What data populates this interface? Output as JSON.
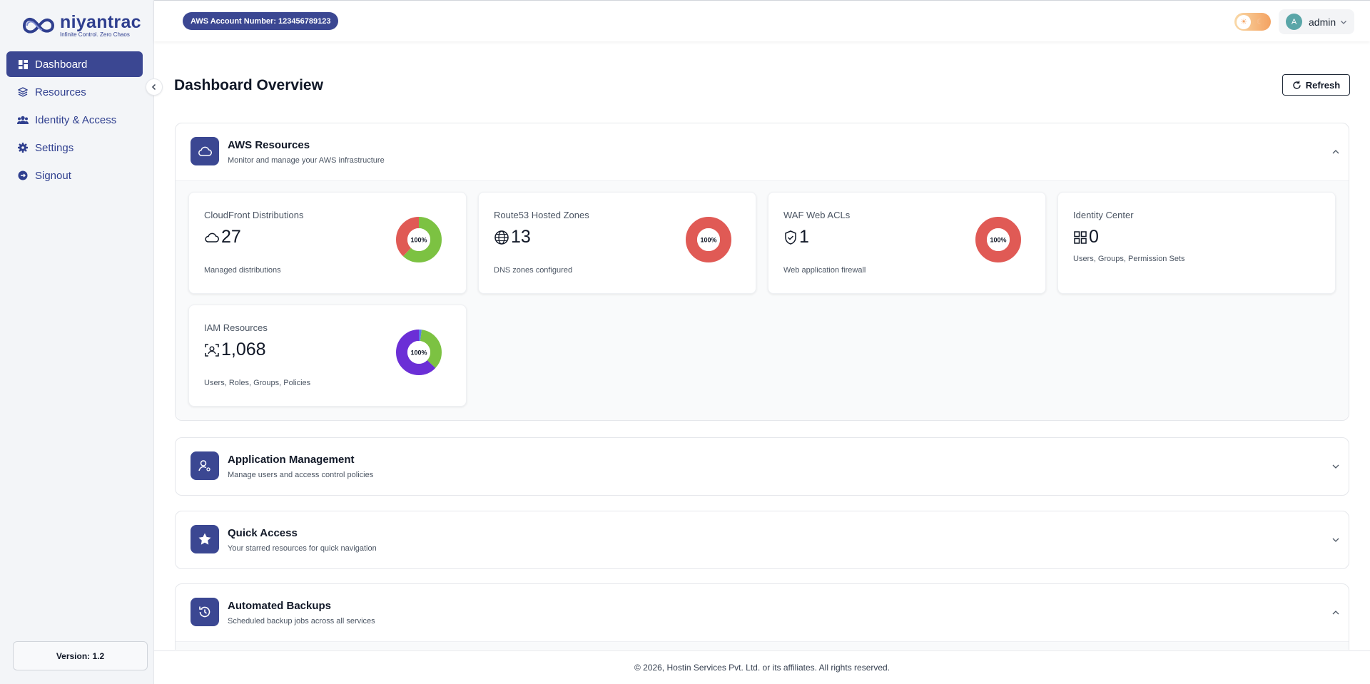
{
  "brand": {
    "name": "niyantrac",
    "tagline": "Infinite Control. Zero Chaos"
  },
  "sidebar": {
    "items": [
      {
        "label": "Dashboard",
        "icon": "grid-icon",
        "active": true
      },
      {
        "label": "Resources",
        "icon": "layers-icon",
        "active": false
      },
      {
        "label": "Identity & Access",
        "icon": "users-icon",
        "active": false
      },
      {
        "label": "Settings",
        "icon": "gear-icon",
        "active": false
      },
      {
        "label": "Signout",
        "icon": "signout-icon",
        "active": false
      }
    ],
    "version": "Version: 1.2"
  },
  "topbar": {
    "account": "AWS Account Number: 123456789123",
    "user": {
      "initial": "A",
      "name": "admin"
    }
  },
  "page": {
    "title": "Dashboard Overview",
    "refresh_label": "Refresh"
  },
  "sections": {
    "aws": {
      "title": "AWS Resources",
      "subtitle": "Monitor and manage your AWS infrastructure",
      "expanded": true
    },
    "app": {
      "title": "Application Management",
      "subtitle": "Manage users and access control policies",
      "expanded": false
    },
    "quick": {
      "title": "Quick Access",
      "subtitle": "Your starred resources for quick navigation",
      "expanded": false
    },
    "backups": {
      "title": "Automated Backups",
      "subtitle": "Scheduled backup jobs across all services",
      "expanded": true
    }
  },
  "cards": [
    {
      "title": "CloudFront Distributions",
      "value": "27",
      "desc": "Managed distributions",
      "icon": "cloud-icon",
      "donut_label": "100%"
    },
    {
      "title": "Route53 Hosted Zones",
      "value": "13",
      "desc": "DNS zones configured",
      "icon": "globe-icon",
      "donut_label": "100%"
    },
    {
      "title": "WAF Web ACLs",
      "value": "1",
      "desc": "Web application firewall",
      "icon": "shield-icon",
      "donut_label": "100%"
    },
    {
      "title": "Identity Center",
      "value": "0",
      "desc": "Users, Groups, Permission Sets",
      "icon": "apps-icon"
    },
    {
      "title": "IAM Resources",
      "value": "1,068",
      "desc": "Users, Roles, Groups, Policies",
      "icon": "scan-face-icon",
      "donut_label": "100%"
    }
  ],
  "colors": {
    "primary": "#3b4792",
    "green": "#7cc242",
    "red": "#e05a55",
    "purple": "#6b2fd6",
    "blue": "#5b7de8"
  },
  "donuts": {
    "cloudfront": [
      {
        "value": 0.62,
        "color": "#7cc242"
      },
      {
        "value": 0.38,
        "color": "#e05a55"
      }
    ],
    "route53": [
      {
        "value": 1.0,
        "color": "#e05a55"
      }
    ],
    "waf": [
      {
        "value": 1.0,
        "color": "#e05a55"
      }
    ],
    "iam": [
      {
        "value": 0.02,
        "color": "#5b7de8"
      },
      {
        "value": 0.35,
        "color": "#7cc242"
      },
      {
        "value": 0.63,
        "color": "#6b2fd6"
      }
    ]
  },
  "footer": "© 2026, Hostin Services Pvt. Ltd. or its affiliates. All rights reserved."
}
